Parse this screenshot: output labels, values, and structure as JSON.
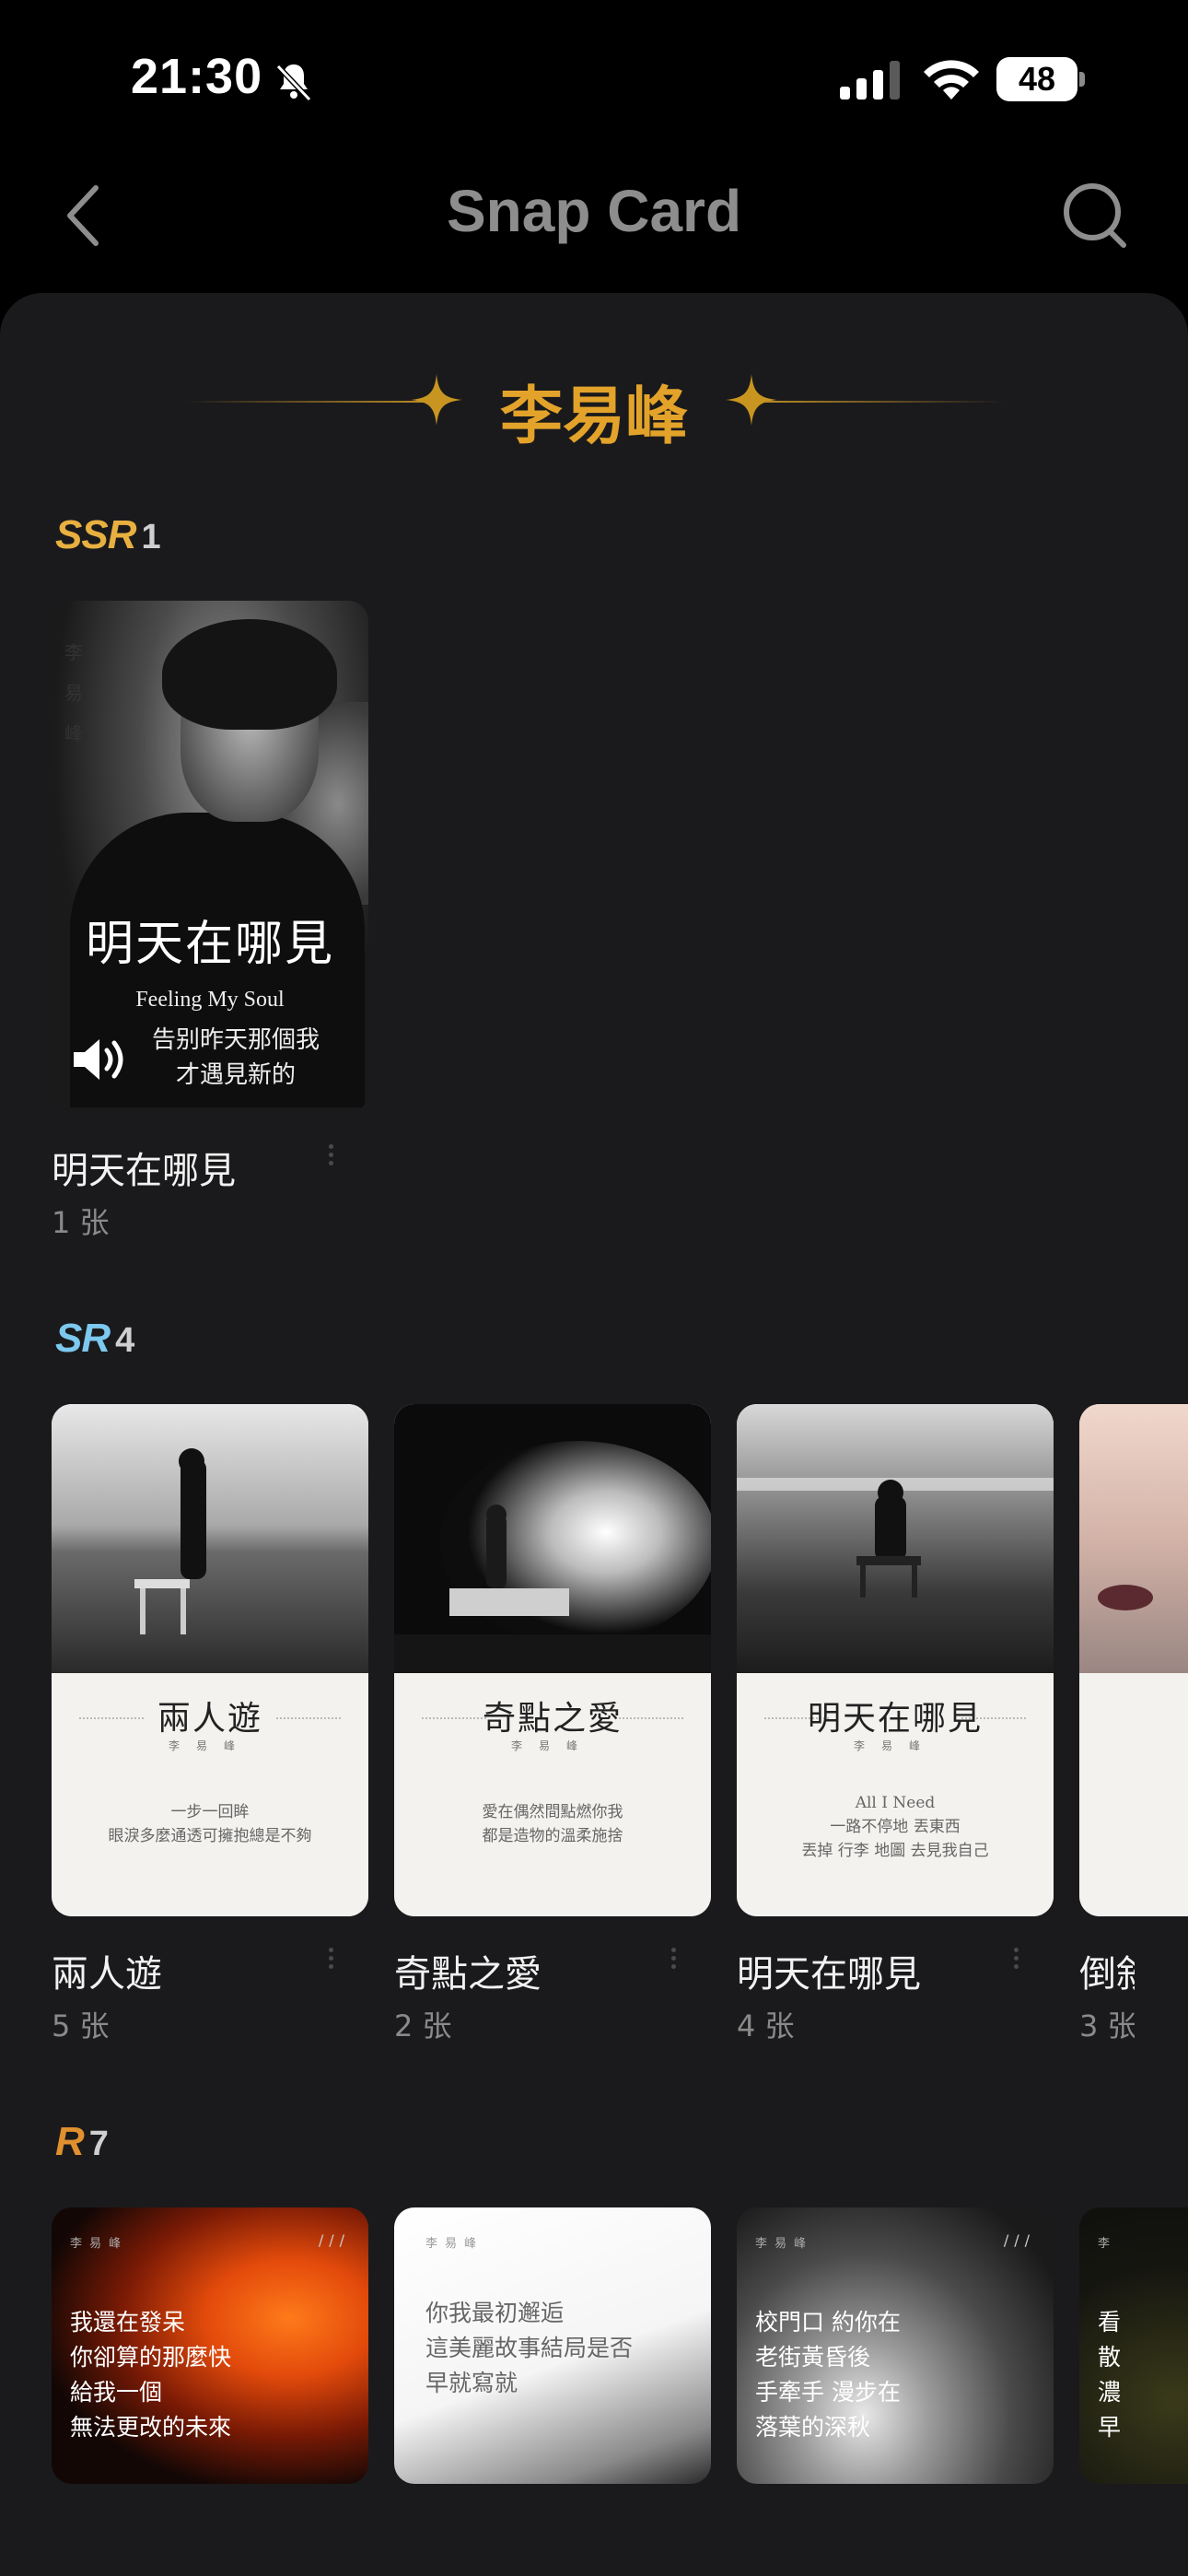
{
  "status_bar": {
    "time": "21:30",
    "battery": "48"
  },
  "nav": {
    "title": "Snap Card"
  },
  "artist": {
    "name": "李易峰"
  },
  "sections": {
    "ssr": {
      "badge": "SSR",
      "count": "1",
      "cards": [
        {
          "title": "明天在哪見",
          "qty": "1 张",
          "art_side": "李易峰",
          "art_big": "明天在哪見",
          "art_eng": "Feeling My Soul",
          "art_line1": "告别昨天那個我",
          "art_line2": "才遇見新的"
        }
      ]
    },
    "sr": {
      "badge": "SR",
      "count": "4",
      "cards": [
        {
          "title": "兩人遊",
          "qty": "5 张",
          "art_script": "兩人遊",
          "art_artist": "李易峰",
          "art_lyric1": "一步一回眸",
          "art_lyric2": "眼淚多麼通透可擁抱總是不夠"
        },
        {
          "title": "奇點之愛",
          "qty": "2 张",
          "art_script": "奇點之愛",
          "art_artist": "李易峰",
          "art_lyric1": "愛在偶然間點燃你我",
          "art_lyric2": "都是造物的溫柔施捨"
        },
        {
          "title": "明天在哪見",
          "qty": "4 张",
          "art_script": "明天在哪見",
          "art_artist": "李易峰",
          "art_lyric0": "All I Need",
          "art_lyric1": "一路不停地 丟東西",
          "art_lyric2": "丟掉 行李 地圖 去見我自己"
        },
        {
          "title": "倒敘",
          "qty": "3 张"
        }
      ]
    },
    "r": {
      "badge": "R",
      "count": "7",
      "cards": [
        {
          "mini": "李易峰",
          "slash": "///",
          "lines": [
            "我還在發呆",
            "你卻算的那麼快",
            "給我一個",
            "無法更改的未來"
          ]
        },
        {
          "mini": "李易峰",
          "lines": [
            "你我最初邂逅",
            "這美麗故事結局是否",
            "早就寫就"
          ]
        },
        {
          "mini": "李易峰",
          "slash": "///",
          "lines": [
            "校門口 約你在",
            "老街黃昏後",
            "手牽手 漫步在",
            "落葉的深秋"
          ]
        },
        {
          "mini": "李",
          "lines": [
            "看",
            "散",
            "濃",
            "早"
          ]
        }
      ]
    }
  },
  "colors": {
    "gold": "#e3a32a",
    "ssr": "#e8b040",
    "sr": "#7cc8ee",
    "r": "#e0902e",
    "panel": "#1a1a1c"
  }
}
